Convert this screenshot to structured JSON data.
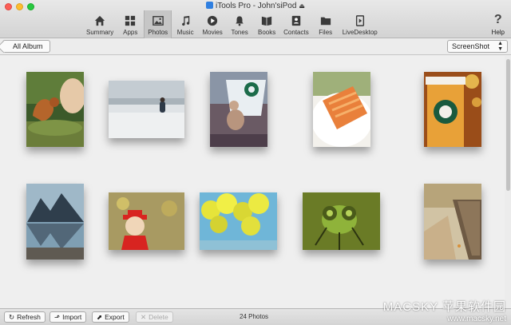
{
  "window": {
    "title": "iTools Pro - John'siPod"
  },
  "toolbar": {
    "items": [
      {
        "label": "Summary",
        "icon": "home-icon"
      },
      {
        "label": "Apps",
        "icon": "apps-icon"
      },
      {
        "label": "Photos",
        "icon": "photos-icon",
        "active": true
      },
      {
        "label": "Music",
        "icon": "music-icon"
      },
      {
        "label": "Movies",
        "icon": "movies-icon"
      },
      {
        "label": "Tones",
        "icon": "bell-icon"
      },
      {
        "label": "Books",
        "icon": "books-icon"
      },
      {
        "label": "Contacts",
        "icon": "contacts-icon"
      },
      {
        "label": "Files",
        "icon": "folder-icon"
      },
      {
        "label": "LiveDesktop",
        "icon": "livedesktop-icon"
      }
    ],
    "help_label": "Help",
    "help_glyph": "?"
  },
  "subbar": {
    "back_label": "All Album",
    "album_select": "ScreenShot"
  },
  "bottom": {
    "refresh": "Refresh",
    "import": "Import",
    "export": "Export",
    "delete": "Delete",
    "count": "24 Photos"
  },
  "watermark": {
    "line1": "MACSKY 苹果软件园",
    "line2": "www.macsky.net"
  },
  "colors": {
    "accent": "#2f7fe0",
    "toolbar_active": "#c6c6c6",
    "background": "#efefef"
  }
}
